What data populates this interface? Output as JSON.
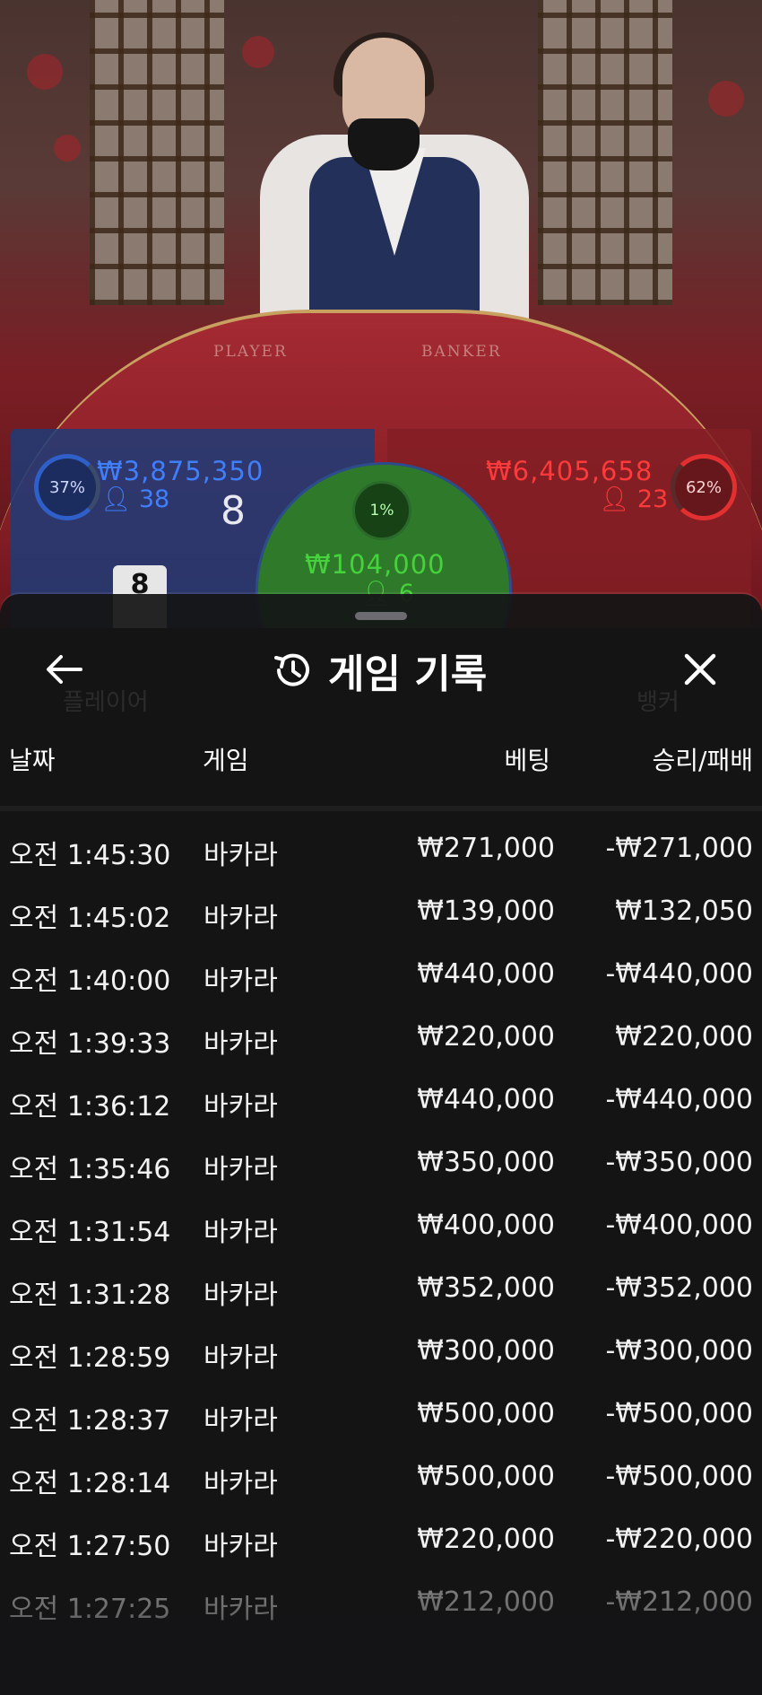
{
  "video": {
    "table_labels": {
      "player": "PLAYER",
      "banker": "BANKER"
    },
    "player": {
      "percent": "37%",
      "amount": "₩3,875,350",
      "count": "38",
      "score": "8",
      "card_rank": "8"
    },
    "banker": {
      "percent": "62%",
      "amount": "₩6,405,658",
      "count": "23"
    },
    "tie": {
      "percent": "1%",
      "amount": "₩104,000",
      "count": "6"
    },
    "colors": {
      "player": "#2f5fc8",
      "banker": "#e23030",
      "tie": "#3fbf3a"
    }
  },
  "sheet": {
    "title": "게임 기록",
    "icons": {
      "back": "arrow-left-icon",
      "history": "history-clock-icon",
      "close": "close-icon"
    },
    "columns": {
      "date": "날짜",
      "game": "게임",
      "bet": "베팅",
      "result": "승리/패배"
    },
    "rows": [
      {
        "date": "오전 1:45:30",
        "game": "바카라",
        "bet": "₩271,000",
        "result": "-₩271,000"
      },
      {
        "date": "오전 1:45:02",
        "game": "바카라",
        "bet": "₩139,000",
        "result": "₩132,050"
      },
      {
        "date": "오전 1:40:00",
        "game": "바카라",
        "bet": "₩440,000",
        "result": "-₩440,000"
      },
      {
        "date": "오전 1:39:33",
        "game": "바카라",
        "bet": "₩220,000",
        "result": "₩220,000"
      },
      {
        "date": "오전 1:36:12",
        "game": "바카라",
        "bet": "₩440,000",
        "result": "-₩440,000"
      },
      {
        "date": "오전 1:35:46",
        "game": "바카라",
        "bet": "₩350,000",
        "result": "-₩350,000"
      },
      {
        "date": "오전 1:31:54",
        "game": "바카라",
        "bet": "₩400,000",
        "result": "-₩400,000"
      },
      {
        "date": "오전 1:31:28",
        "game": "바카라",
        "bet": "₩352,000",
        "result": "-₩352,000"
      },
      {
        "date": "오전 1:28:59",
        "game": "바카라",
        "bet": "₩300,000",
        "result": "-₩300,000"
      },
      {
        "date": "오전 1:28:37",
        "game": "바카라",
        "bet": "₩500,000",
        "result": "-₩500,000"
      },
      {
        "date": "오전 1:28:14",
        "game": "바카라",
        "bet": "₩500,000",
        "result": "-₩500,000"
      },
      {
        "date": "오전 1:27:50",
        "game": "바카라",
        "bet": "₩220,000",
        "result": "-₩220,000"
      },
      {
        "date": "오전 1:27:25",
        "game": "바카라",
        "bet": "₩212,000",
        "result": "-₩212,000"
      }
    ]
  }
}
